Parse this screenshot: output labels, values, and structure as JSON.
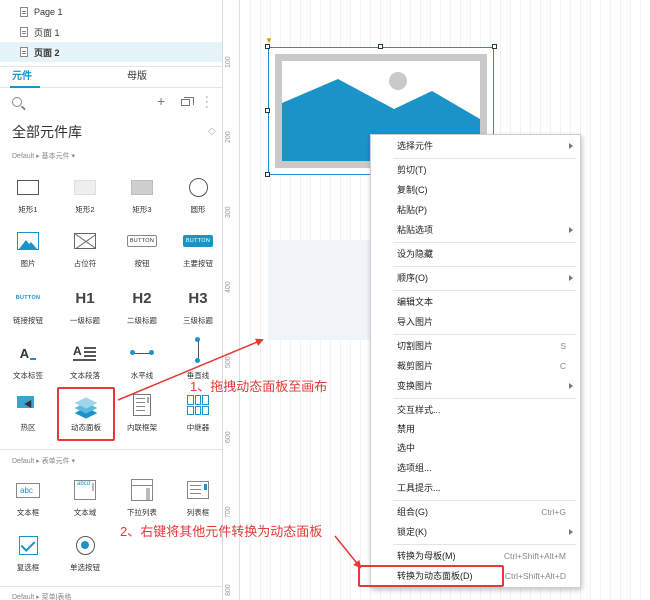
{
  "pages": [
    {
      "label": "Page 1",
      "selected": false
    },
    {
      "label": "页面 1",
      "selected": false
    },
    {
      "label": "页面 2",
      "selected": true
    }
  ],
  "tabs": {
    "widgets": "元件",
    "masters": "母版"
  },
  "library": {
    "title": "全部元件库"
  },
  "sections": {
    "basic": "Default ▸ 基本元件 ▾",
    "form": "Default ▸ 表单元件 ▾",
    "menu": "Default ▸ 菜单|表格"
  },
  "widgets_basic": [
    "矩形1",
    "矩形2",
    "矩形3",
    "圆形",
    "图片",
    "占位符",
    "按钮",
    "主要按钮",
    "链接按钮",
    "一级标题",
    "二级标题",
    "三级标题",
    "文本标签",
    "文本段落",
    "水平线",
    "垂直线",
    "热区",
    "动态面板",
    "内联框架",
    "中继器"
  ],
  "widgets_form": [
    "文本框",
    "文本域",
    "下拉列表",
    "列表框",
    "复选框",
    "单选按钮"
  ],
  "icon_text": {
    "button": "BUTTON",
    "h1": "H1",
    "h2": "H2",
    "h3": "H3",
    "label": "A",
    "para": "A",
    "textbox": "abc",
    "textarea": "abcd"
  },
  "ruler": [
    "100",
    "200",
    "300",
    "400",
    "500",
    "600",
    "700",
    "800"
  ],
  "menu": {
    "select": "选择元件",
    "cut": "剪切(T)",
    "copy": "复制(C)",
    "paste": "粘贴(P)",
    "paste_opts": "粘贴选项",
    "hide": "设为隐藏",
    "order": "顺序(O)",
    "edit_text": "编辑文本",
    "import_img": "导入图片",
    "slice": "切割图片",
    "slice_sc": "S",
    "crop": "裁剪图片",
    "crop_sc": "C",
    "transform": "变换图片",
    "interaction": "交互样式...",
    "disable": "禁用",
    "selected": "选中",
    "option_group": "选项组...",
    "tooltip": "工具提示...",
    "group": "组合(G)",
    "group_sc": "Ctrl+G",
    "lock": "锁定(K)",
    "to_master": "转换为母板(M)",
    "to_master_sc": "Ctrl+Shift+Alt+M",
    "to_dp": "转换为动态面板(D)",
    "to_dp_sc": "Ctrl+Shift+Alt+D"
  },
  "annotations": {
    "step1": "1、拖拽动态面板至画布",
    "step2": "2、右键将其他元件转换为动态面板"
  },
  "colors": {
    "accent": "#1a93c9",
    "annotation": "#e53935"
  }
}
